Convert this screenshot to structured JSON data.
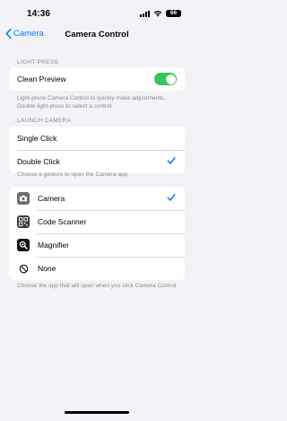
{
  "status": {
    "time": "14:36",
    "battery": "66"
  },
  "nav": {
    "back_label": "Camera",
    "title": "Camera Control"
  },
  "light_press": {
    "header": "LIGHT PRESS",
    "clean_preview_label": "Clean Preview",
    "clean_preview_on": true,
    "footer": "Light-press Camera Control to quickly make adjustments. Double light-press to select a control."
  },
  "launch_camera": {
    "header": "LAUNCH CAMERA",
    "options": [
      {
        "label": "Single Click",
        "selected": false
      },
      {
        "label": "Double Click",
        "selected": true
      }
    ],
    "footer": "Choose a gesture to open the Camera app."
  },
  "apps": {
    "options": [
      {
        "label": "Camera",
        "icon": "camera-icon",
        "selected": true
      },
      {
        "label": "Code Scanner",
        "icon": "qr-code-icon",
        "selected": false
      },
      {
        "label": "Magnifier",
        "icon": "magnifier-icon",
        "selected": false
      },
      {
        "label": "None",
        "icon": "none-icon",
        "selected": false
      }
    ],
    "footer": "Choose the app that will open when you click Camera Control."
  },
  "colors": {
    "accent": "#007aff",
    "toggle_on": "#34c759",
    "background": "#f2f2f7"
  }
}
